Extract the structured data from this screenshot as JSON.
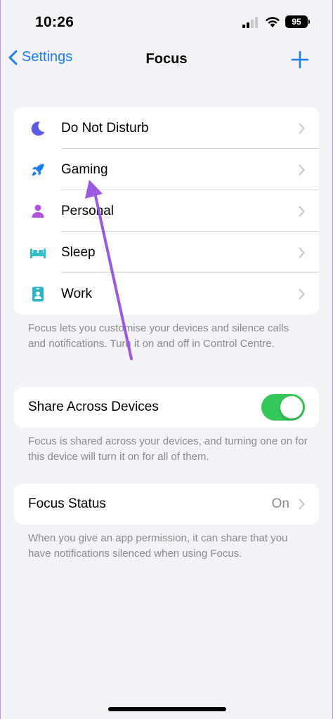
{
  "status_bar": {
    "time": "10:26",
    "battery": "95"
  },
  "nav": {
    "back_label": "Settings",
    "title": "Focus"
  },
  "focus_modes": [
    {
      "label": "Do Not Disturb",
      "icon": "moon-icon",
      "color": "#5e5ce6"
    },
    {
      "label": "Gaming",
      "icon": "rocket-icon",
      "color": "#1a7ff0"
    },
    {
      "label": "Personal",
      "icon": "person-icon",
      "color": "#af52de"
    },
    {
      "label": "Sleep",
      "icon": "bed-icon",
      "color": "#30c0c8"
    },
    {
      "label": "Work",
      "icon": "id-badge-icon",
      "color": "#2fb3c6"
    }
  ],
  "focus_footnote": "Focus lets you customise your devices and silence calls and notifications. Turn it on and off in Control Centre.",
  "share": {
    "label": "Share Across Devices",
    "enabled": true,
    "footnote": "Focus is shared across your devices, and turning one on for this device will turn it on for all of them."
  },
  "focus_status": {
    "label": "Focus Status",
    "value": "On",
    "footnote": "When you give an app permission, it can share that you have notifications silenced when using Focus."
  },
  "colors": {
    "accent": "#1a7ff0",
    "toggle_on": "#34c759",
    "annotation_arrow": "#9b59e0"
  }
}
